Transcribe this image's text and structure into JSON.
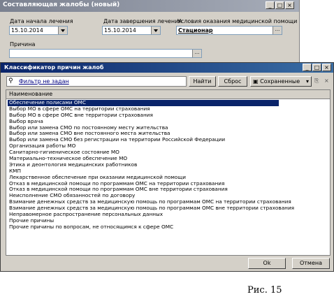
{
  "back_window": {
    "title": "Составляющая жалобы (новый)",
    "start_date_label": "Дата начала лечения",
    "start_date_value": "15.10.2014",
    "end_date_label": "Дата завершения лечения",
    "end_date_value": "15.10.2014",
    "conditions_label": "Условия оказания медицинской помощи",
    "conditions_value": "Стационар",
    "reason_label": "Причина",
    "reason_value": ""
  },
  "dialog": {
    "title": "Классификатор причин жалоб",
    "filter_text": "Фильтр не задан",
    "find_button": "Найти",
    "reset_button": "Сброс",
    "saved_button": "Сохраненные",
    "column_header": "Наименование",
    "items": [
      "Обеспечение полисами ОМС",
      "Выбор МО в сфере ОМС на территории страхования",
      "Выбор МО в сфере ОМС вне территории страхования",
      "Выбор врача",
      "Выбор или замена СМО по постоянному месту жительства",
      "Выбор или замена СМО вне постоянного места жительства",
      "Выбор или замена СМО без регистрации на территории Российской Федерации",
      "Организация работы МО",
      "Санитарно-гигиеническое состояние МО",
      "Материально-техническое обеспечение МО",
      "Этика и деонтология медицинских работников",
      "КМП",
      "Лекарственное обеспечение при оказании медицинской помощи",
      "Отказ в медицинской помощи по программам ОМС на территории страхования",
      "Отказ в медицинской помощи по программам ОМС вне территории страхования",
      "Неисполнение СМО обязанностей по договору",
      "Взимание денежных средств за медицинскую помощь по программам ОМС на территории страхования",
      "Взимание денежных средств за медицинскую помощь по программам ОМС вне территории страхования",
      "Неправомерное распространение персональных данных",
      "Прочие причины",
      "Прочие причины по вопросам, не относящимся к сфере ОМС"
    ],
    "selected_index": 0,
    "ok_button": "Ok",
    "cancel_button": "Отмена"
  },
  "window_controls": {
    "minimize": "_",
    "maximize": "□",
    "close": "×"
  },
  "caption": "Рис. 15",
  "colors": {
    "titlebar_active": "#0a246a",
    "titlebar_inactive": "#7b8190",
    "selection": "#0a246a",
    "face": "#d4d0c8"
  }
}
